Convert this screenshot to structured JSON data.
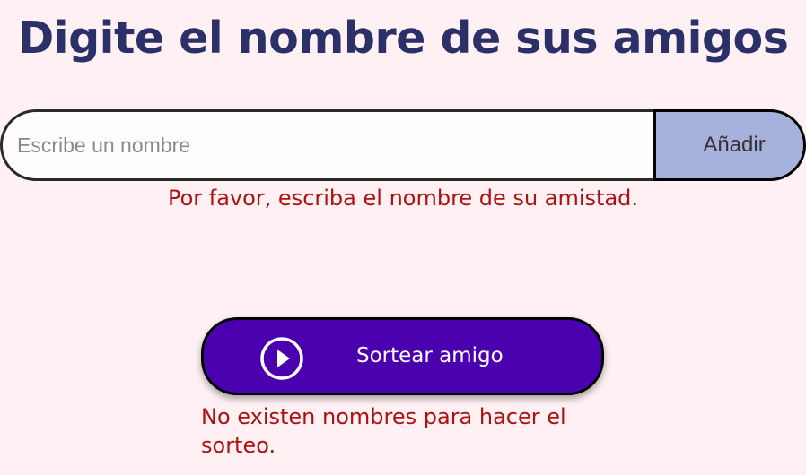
{
  "heading": "Digite el nombre de sus amigos",
  "name_input": {
    "value": "",
    "placeholder": "Escribe un nombre"
  },
  "add_button_label": "Añadir",
  "name_error": "Por favor, escriba el nombre de su amistad.",
  "draw_button": {
    "label": "Sortear amigo",
    "icon": "play-circle-icon"
  },
  "draw_error": "No existen nombres para hacer el sorteo.",
  "colors": {
    "background": "#fff1f3",
    "heading": "#2c3068",
    "add_button": "#a7b2dc",
    "draw_button": "#4b00b0",
    "error_text": "#b01010"
  }
}
